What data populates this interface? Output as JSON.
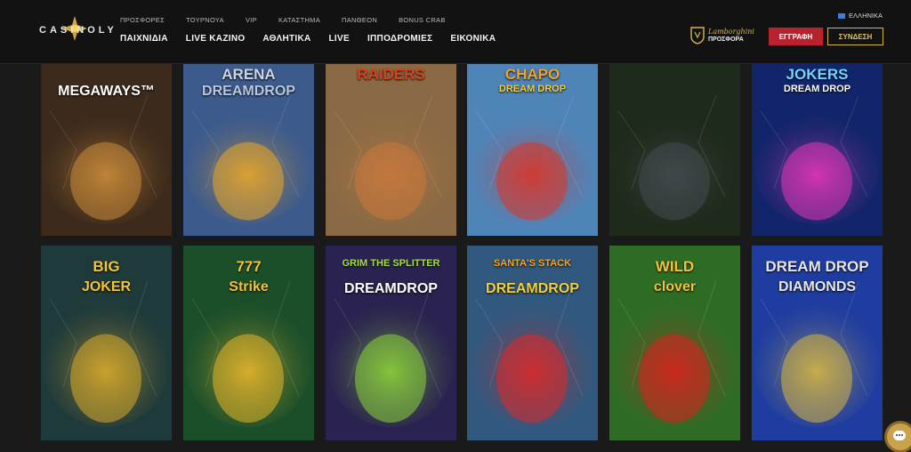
{
  "header": {
    "logo": "CASINOLY",
    "top_links": [
      "ΠΡΟΣΦΟΡΕΣ",
      "ΤΟΥΡΝΟΥΑ",
      "VIP",
      "ΚΑΤΑΣΤΗΜΑ",
      "ΠΑΝΘΕΟΝ",
      "BONUS CRAB"
    ],
    "main_links": [
      "ΠΑΙΧΝΙΔΙΑ",
      "LIVE ΚΑΖΙΝΟ",
      "ΑΘΛΗΤΙΚΑ",
      "LIVE",
      "ΙΠΠΟΔΡΟΜΙΕΣ",
      "ΕΙΚΟΝΙΚΑ"
    ],
    "language": "ΕΛΛΗΝΙΚΑ",
    "promo_brand": "Lamborghini",
    "promo_label": "ΠΡΟΣΦΟΡΑ",
    "register": "ΕΓΓΡΑΦΗ",
    "login": "ΣΥΝΔΕΣΗ"
  },
  "games": [
    {
      "line1": "",
      "line2": "MEGAWAYS™",
      "bg": "#3c2a1c",
      "accent": "#c98a3a",
      "t1c": "#f0c040",
      "t2c": "#ffffff"
    },
    {
      "line1": "ARENA",
      "line2": "DREAMDROP",
      "bg": "#3c5a8c",
      "accent": "#e7a52a",
      "t1c": "#cfd6e2",
      "t2c": "#b9c7e0"
    },
    {
      "line1": "RAIDERS",
      "line2": "",
      "bg": "#8a6a44",
      "accent": "#c9793d",
      "t1c": "#d8431d",
      "t2c": "#fff"
    },
    {
      "line1": "CHAPO",
      "line2": "DREAM DROP",
      "bg": "#4f84b8",
      "accent": "#d9362a",
      "t1c": "#f2a229",
      "t2c": "#f2d03a"
    },
    {
      "line1": "",
      "line2": "",
      "bg": "#1e2a1a",
      "accent": "#444a50",
      "t1c": "#fff",
      "t2c": "#fff"
    },
    {
      "line1": "JOKERS",
      "line2": "DREAM DROP",
      "bg": "#12256a",
      "accent": "#e037b6",
      "t1c": "#6fd5ff",
      "t2c": "#ffffff"
    },
    {
      "line1": "BIG",
      "line2": "JOKER",
      "bg": "#1f3a3a",
      "accent": "#d7a92c",
      "t1c": "#f4c533",
      "t2c": "#f4c533"
    },
    {
      "line1": "777",
      "line2": "Strike",
      "bg": "#1b4f2a",
      "accent": "#e4b42a",
      "t1c": "#f2c23c",
      "t2c": "#f2c23c"
    },
    {
      "line1": "GRIM THE SPLITTER",
      "line2": "DREAMDROP",
      "bg": "#2a2250",
      "accent": "#8ad13a",
      "t1c": "#a6e03a",
      "t2c": "#ffffff"
    },
    {
      "line1": "SANTA'S STACK",
      "line2": "DREAMDROP",
      "bg": "#31587e",
      "accent": "#d92a2a",
      "t1c": "#f5a623",
      "t2c": "#f4d03a"
    },
    {
      "line1": "WILD",
      "line2": "clover",
      "bg": "#2e6c25",
      "accent": "#d7231f",
      "t1c": "#f2c23c",
      "t2c": "#f2c23c"
    },
    {
      "line1": "DREAM DROP",
      "line2": "DIAMONDS",
      "bg": "#1f3da0",
      "accent": "#d3b544",
      "t1c": "#e7e7e7",
      "t2c": "#e7e7e7"
    }
  ]
}
